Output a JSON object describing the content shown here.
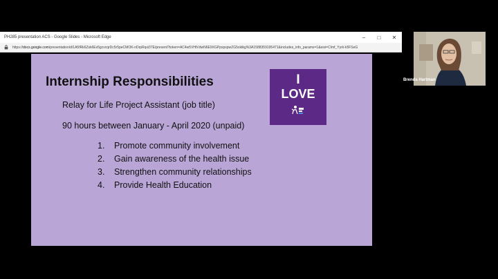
{
  "window": {
    "title": "PH285 presentation ACS - Google Slides - Microsoft Edge",
    "minimize_icon": "minimize-icon",
    "maximize_icon": "maximize-icon",
    "close_icon": "close-icon"
  },
  "address_bar": {
    "prefix": "https://",
    "host": "docs.google.com",
    "path": "/presentation/d/1A5fRk6Zsk6Ex5gcvcqrDc5r5peCMOK-nDrpRqxi37E/present?token=AC4w5VHtVdwN6E9XGPpxpspwZG5oldkg%3A1588359195471&includes_info_params=1&eisi=CImf_Yyrk-k5FSeG"
  },
  "slide": {
    "background": "#b9a5d6",
    "title": "Internship Responsibilities",
    "line1": "Relay for Life Project Assistant (job title)",
    "line2": "90 hours between January - April 2020 (unpaid)",
    "list": [
      {
        "num": "1.",
        "text": "Promote community involvement"
      },
      {
        "num": "2.",
        "text": "Gain awareness of the health issue"
      },
      {
        "num": "3.",
        "text": "Strengthen community relationships"
      },
      {
        "num": "4.",
        "text": "Provide Health Education"
      }
    ],
    "logo": {
      "line1": "I",
      "line2": "LOVE",
      "color": "#5c2a86"
    }
  },
  "participant": {
    "name": "Brenda Hartman"
  }
}
